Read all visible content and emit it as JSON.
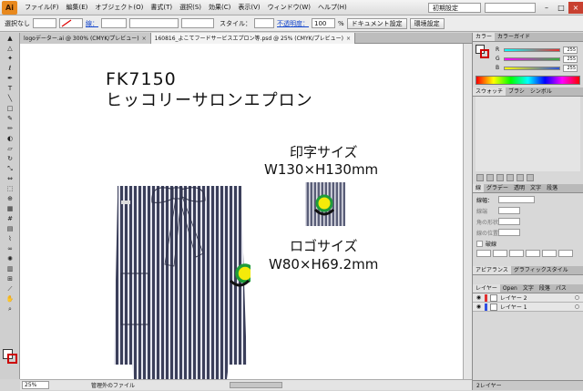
{
  "menubar": {
    "logo": "Ai",
    "items": [
      "ファイル(F)",
      "編集(E)",
      "オブジェクト(O)",
      "書式(T)",
      "選択(S)",
      "効果(C)",
      "表示(V)",
      "ウィンドウ(W)",
      "ヘルプ(H)"
    ],
    "workspace": "初期設定",
    "controls": [
      "–",
      "□",
      "×"
    ]
  },
  "controlbar": {
    "selection": "選択なし",
    "stroke_label": "線：",
    "style_label": "スタイル：",
    "opacity_label": "不透明度：",
    "opacity_value": "100",
    "opacity_unit": "%",
    "document_settings": "ドキュメント設定",
    "preferences": "環境設定"
  },
  "tabs": [
    {
      "label": "logoデーター.ai @ 300% (CMYK/プレビュー)",
      "active": false
    },
    {
      "label": "160816_よこてフードサービスエプロン等.psd @ 25% (CMYK/プレビュー)",
      "active": true
    }
  ],
  "canvas": {
    "product_code": "FK7150",
    "product_name": "ヒッコリーサロンエプロン",
    "print_label": "印字サイズ",
    "print_size": "W130×H130mm",
    "logo_label": "ロゴサイズ",
    "logo_size": "W80×H69.2mm"
  },
  "statusbar": {
    "zoom": "25%",
    "status": "管理外のファイル"
  },
  "color_panel": {
    "tabs": [
      "カラー",
      "カラーガイド"
    ],
    "rows": [
      {
        "label": "R",
        "value": "255",
        "color": "#e53030"
      },
      {
        "label": "G",
        "value": "255",
        "color": "#33b33a"
      },
      {
        "label": "B",
        "value": "255",
        "color": "#2c52d8"
      }
    ]
  },
  "swatch_panel": {
    "tabs": [
      "スウォッチ",
      "ブラシ",
      "シンボル"
    ]
  },
  "stroke_panel": {
    "tabs": [
      "線",
      "グラデー",
      "透明",
      "文字",
      "段落"
    ],
    "weight_label": "線幅：",
    "fields": [
      "線端",
      "角の形状",
      "線の位置"
    ],
    "dashed_label": "破線"
  },
  "appearance_panel": {
    "tabs": [
      "アピアランス",
      "グラフィックスタイル"
    ]
  },
  "layers_panel": {
    "tabs": [
      "レイヤー",
      "Open",
      "文字",
      "段落",
      "パス"
    ],
    "layers": [
      {
        "name": "レイヤー 2",
        "color": "#e03030"
      },
      {
        "name": "レイヤー 1",
        "color": "#3050e0"
      }
    ],
    "footer": "2レイヤー"
  },
  "colors": {
    "accent": "#e8891e",
    "logo_yellow": "#f4ea0a",
    "logo_green": "#1f9c3a",
    "denim": "#3b3f5a"
  }
}
